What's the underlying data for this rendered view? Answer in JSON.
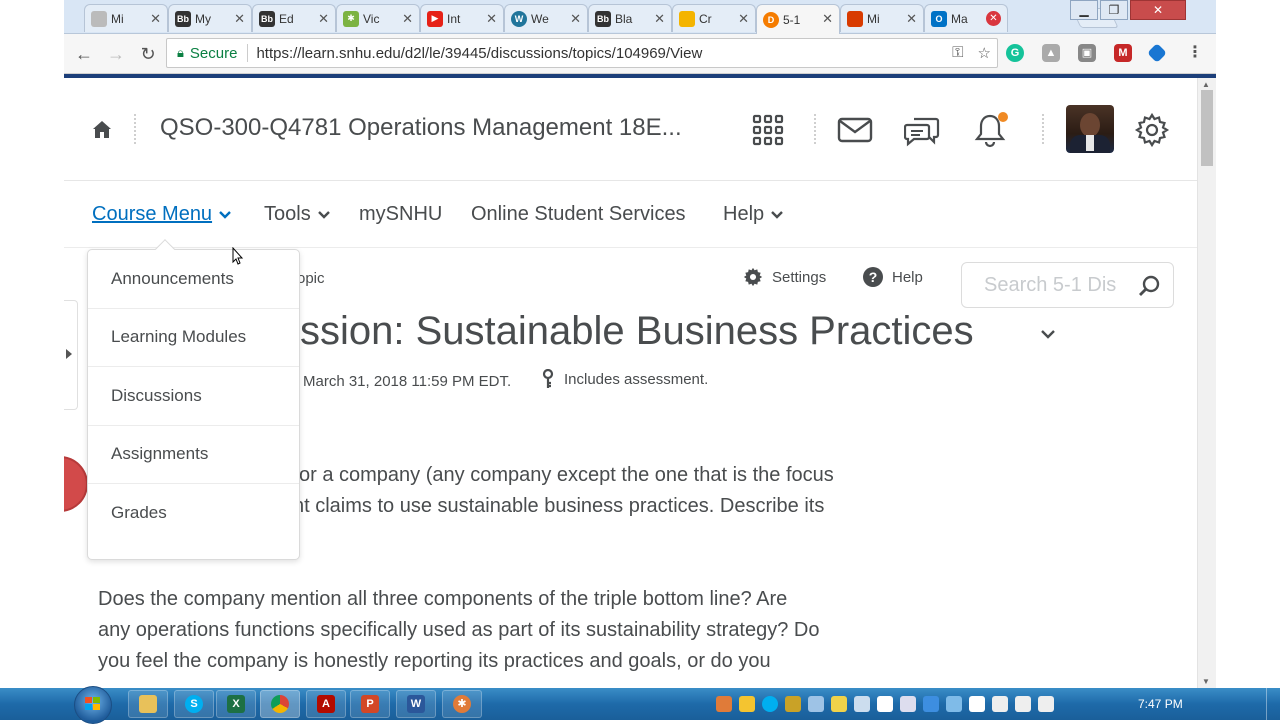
{
  "browser": {
    "tabs": [
      {
        "label": "Mi",
        "favicon": "doc-icon",
        "color": "#999999"
      },
      {
        "label": "My",
        "favicon": "bb-icon",
        "color": "#333333"
      },
      {
        "label": "Ed",
        "favicon": "bb-icon",
        "color": "#333333"
      },
      {
        "label": "Vic",
        "favicon": "sun-icon",
        "color": "#7cb342"
      },
      {
        "label": "Int",
        "favicon": "youtube-icon",
        "color": "#e62117"
      },
      {
        "label": "We",
        "favicon": "wordpress-icon",
        "color": "#21759b"
      },
      {
        "label": "Bla",
        "favicon": "bb-icon",
        "color": "#333333"
      },
      {
        "label": "Cr",
        "favicon": "slides-icon",
        "color": "#f4b400"
      },
      {
        "label": "5-1",
        "favicon": "d2l-icon",
        "color": "#f57c00"
      },
      {
        "label": "Mi",
        "favicon": "office-icon",
        "color": "#d83b01"
      },
      {
        "label": "Ma",
        "favicon": "outlook-icon",
        "color": "#0072c6"
      }
    ],
    "secure_label": "Secure",
    "url": "https://learn.snhu.edu/d2l/le/39445/discussions/topics/104969/View"
  },
  "header": {
    "course_title": "QSO-300-Q4781 Operations Management 18E..."
  },
  "nav": {
    "course_menu": "Course Menu",
    "tools": "Tools",
    "mysnhu": "mySNHU",
    "online_student_services": "Online Student Services",
    "help": "Help"
  },
  "dropdown": {
    "items": [
      "Announcements",
      "Learning Modules",
      "Discussions",
      "Assignments",
      "Grades"
    ]
  },
  "content": {
    "breadcrumb_tail": "opic",
    "settings_label": "Settings",
    "help_label": "Help",
    "search_placeholder": "Search 5-1 Dis",
    "topic_title": "ssion: Sustainable Business Practices",
    "due_text": "March 31, 2018 11:59 PM EDT.",
    "assessment_text": "Includes assessment.",
    "para1_line1": "or a company (any company except the one that is the focus",
    "para1_line2": "nt claims to use sustainable business practices. Describe its",
    "para2_line1": "Does the company mention all three components of the triple bottom line? Are",
    "para2_line2": "any operations functions specifically used as part of its sustainability strategy? Do",
    "para2_line3": "you feel the company is honestly reporting its practices and goals, or do you"
  },
  "taskbar": {
    "time": "7:47 PM"
  },
  "colors": {
    "link": "#006fbf",
    "text": "#494c4e",
    "brand_bar": "#1c3f7a",
    "notification": "#f08a24"
  }
}
